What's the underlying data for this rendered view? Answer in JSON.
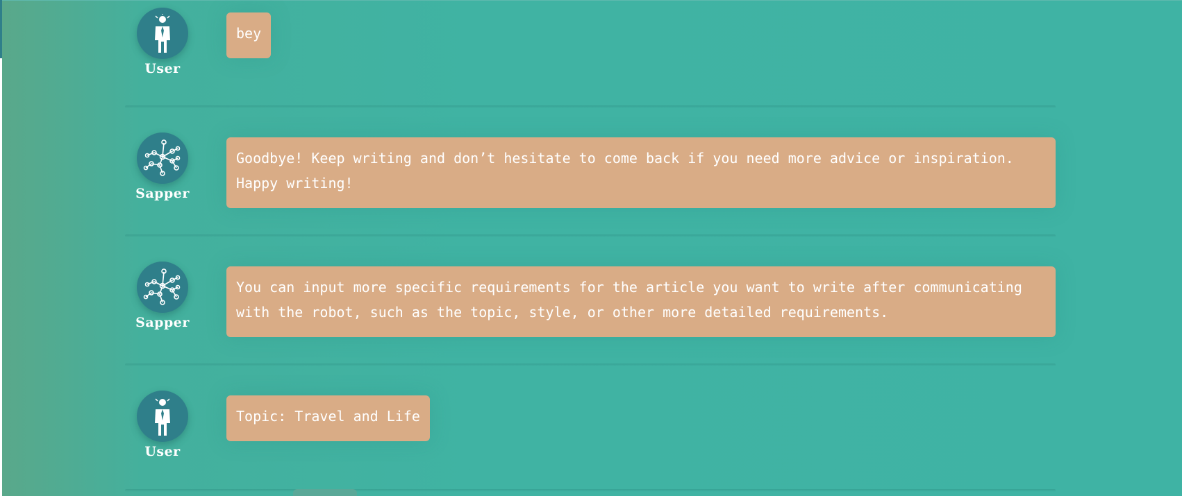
{
  "conversation": {
    "messages": [
      {
        "author": "User",
        "avatar_icon": "user-icon",
        "text": "bey"
      },
      {
        "author": "Sapper",
        "avatar_icon": "neural-network-icon",
        "text": "Goodbye! Keep writing and don’t hesitate to come back if you need more advice or inspiration. Happy writing!"
      },
      {
        "author": "Sapper",
        "avatar_icon": "neural-network-icon",
        "text": "You can input more specific requirements for the article you want to write after communicating with the robot, such as the topic, style, or other more detailed requirements."
      },
      {
        "author": "User",
        "avatar_icon": "user-icon",
        "text": "Topic: Travel and Life"
      }
    ]
  },
  "colors": {
    "background": "#3fb3a4",
    "bubble": "#d9ac86",
    "avatar": "#2f7f8a",
    "text": "#ffffff"
  }
}
